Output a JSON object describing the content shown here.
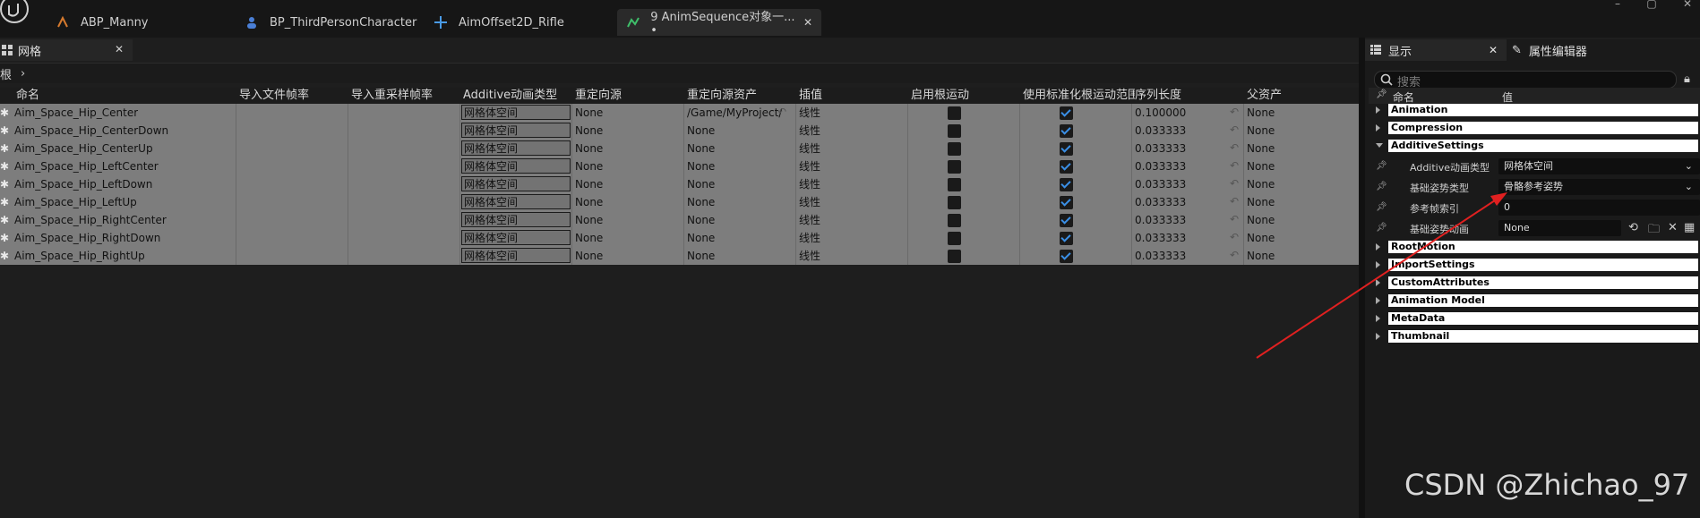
{
  "tabs": [
    {
      "label": "ABP_Manny",
      "icon": "anim-blueprint-icon"
    },
    {
      "label": "BP_ThirdPersonCharacter",
      "icon": "character-icon"
    },
    {
      "label": "AimOffset2D_Rifle",
      "icon": "aim-offset-icon"
    },
    {
      "label": "9 AnimSequence对象一... •",
      "icon": "anim-sequence-icon"
    }
  ],
  "left_panel": {
    "tab": "网格",
    "breadcrumb": "根"
  },
  "columns": [
    "命名",
    "导入文件帧率",
    "导入重采样帧率",
    "Additive动画类型",
    "重定向源",
    "重定向源资产",
    "插值",
    "启用根运动",
    "使用标准化根运动范围",
    "序列长度",
    "父资产"
  ],
  "rows": [
    {
      "name": "Aim_Space_Hip_Center",
      "additive": "网格体空间",
      "retarget": "None",
      "retarget_asset": "/Game/MyProject/",
      "interp": "线性",
      "root_motion": false,
      "norm_root": true,
      "length": "0.100000",
      "parent": "None"
    },
    {
      "name": "Aim_Space_Hip_CenterDown",
      "additive": "网格体空间",
      "retarget": "None",
      "retarget_asset": "None",
      "interp": "线性",
      "root_motion": false,
      "norm_root": true,
      "length": "0.033333",
      "parent": "None"
    },
    {
      "name": "Aim_Space_Hip_CenterUp",
      "additive": "网格体空间",
      "retarget": "None",
      "retarget_asset": "None",
      "interp": "线性",
      "root_motion": false,
      "norm_root": true,
      "length": "0.033333",
      "parent": "None"
    },
    {
      "name": "Aim_Space_Hip_LeftCenter",
      "additive": "网格体空间",
      "retarget": "None",
      "retarget_asset": "None",
      "interp": "线性",
      "root_motion": false,
      "norm_root": true,
      "length": "0.033333",
      "parent": "None"
    },
    {
      "name": "Aim_Space_Hip_LeftDown",
      "additive": "网格体空间",
      "retarget": "None",
      "retarget_asset": "None",
      "interp": "线性",
      "root_motion": false,
      "norm_root": true,
      "length": "0.033333",
      "parent": "None"
    },
    {
      "name": "Aim_Space_Hip_LeftUp",
      "additive": "网格体空间",
      "retarget": "None",
      "retarget_asset": "None",
      "interp": "线性",
      "root_motion": false,
      "norm_root": true,
      "length": "0.033333",
      "parent": "None"
    },
    {
      "name": "Aim_Space_Hip_RightCenter",
      "additive": "网格体空间",
      "retarget": "None",
      "retarget_asset": "None",
      "interp": "线性",
      "root_motion": false,
      "norm_root": true,
      "length": "0.033333",
      "parent": "None"
    },
    {
      "name": "Aim_Space_Hip_RightDown",
      "additive": "网格体空间",
      "retarget": "None",
      "retarget_asset": "None",
      "interp": "线性",
      "root_motion": false,
      "norm_root": true,
      "length": "0.033333",
      "parent": "None"
    },
    {
      "name": "Aim_Space_Hip_RightUp",
      "additive": "网格体空间",
      "retarget": "None",
      "retarget_asset": "None",
      "interp": "线性",
      "root_motion": false,
      "norm_root": true,
      "length": "0.033333",
      "parent": "None"
    }
  ],
  "right_panel": {
    "tab_display": "显示",
    "tab_property": "属性编辑器",
    "search_placeholder": "搜索",
    "col_name": "命名",
    "col_value": "值",
    "categories": [
      "Animation",
      "Compression",
      "AdditiveSettings",
      "RootMotion",
      "ImportSettings",
      "CustomAttributes",
      "Animation Model",
      "MetaData",
      "Thumbnail"
    ],
    "additive_props": [
      {
        "label": "Additive动画类型",
        "value": "网格体空间"
      },
      {
        "label": "基础姿势类型",
        "value": "骨骼参考姿势"
      },
      {
        "label": "参考帧索引",
        "value": "0"
      },
      {
        "label": "基础姿势动画",
        "value": "None"
      }
    ]
  },
  "watermark": "CSDN @Zhichao_97",
  "colors": {
    "annotation_arrow": "#e02020",
    "checkbox_check": "#3a8fe6"
  }
}
